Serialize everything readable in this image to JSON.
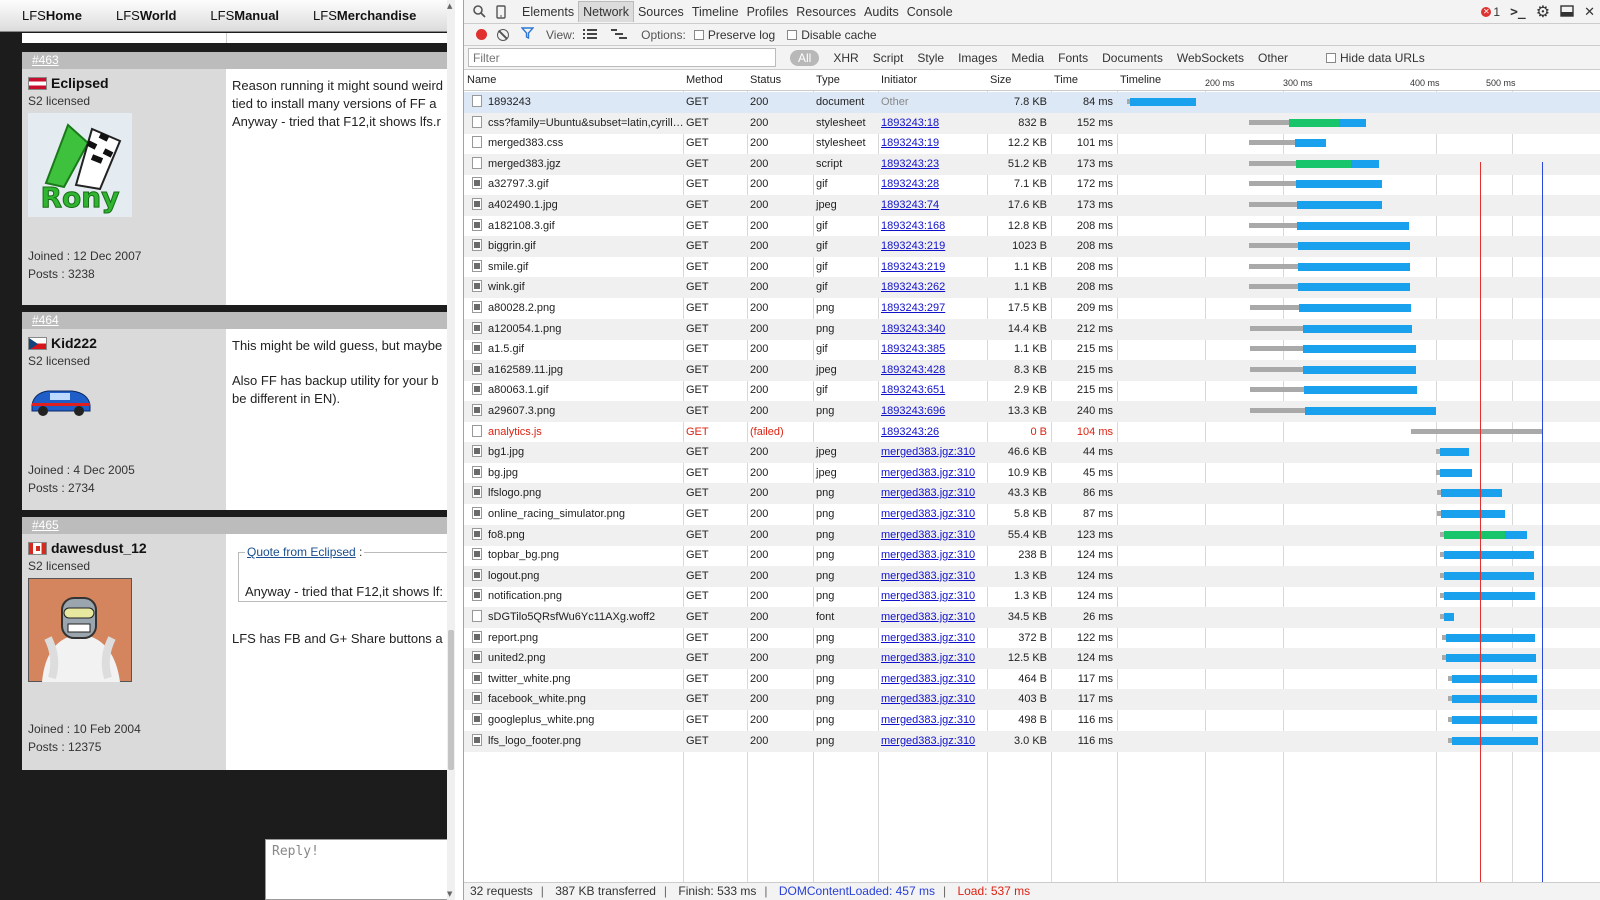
{
  "forum": {
    "nav": [
      {
        "prefix": "LFS",
        "strong": "Home"
      },
      {
        "prefix": "LFS",
        "strong": "World"
      },
      {
        "prefix": "LFS",
        "strong": "Manual"
      },
      {
        "prefix": "LFS",
        "strong": "Merchandise"
      }
    ],
    "posts": [
      {
        "number": "#463",
        "username": "Eclipsed",
        "license": "S2 licensed",
        "joined": "Joined : 12 Dec 2007",
        "posts": "Posts : 3238",
        "avatar_text": "Rony",
        "lines": [
          "Reason running it might sound weird",
          "tied to install many versions of FF a",
          "Anyway - tried that F12,it shows lfs.r"
        ]
      },
      {
        "number": "#464",
        "username": "Kid222",
        "license": "S2 licensed",
        "joined": "Joined : 4 Dec 2005",
        "posts": "Posts : 2734",
        "lines": [
          "This might be wild guess, but maybe",
          "Also FF has backup utility for your b",
          "be different in EN)."
        ]
      },
      {
        "number": "#465",
        "username": "dawesdust_12",
        "license": "S2 licensed",
        "joined": "Joined : 10 Feb 2004",
        "posts": "Posts : 12375",
        "quote_link": "Quote from Eclipsed",
        "quote_colon": " :",
        "quote_text": "Anyway - tried that F12,it shows lf:",
        "lines": [
          "LFS has FB and G+ Share buttons a"
        ]
      }
    ],
    "reply_placeholder": "Reply!"
  },
  "devtools": {
    "tabs": [
      "Elements",
      "Network",
      "Sources",
      "Timeline",
      "Profiles",
      "Resources",
      "Audits",
      "Console"
    ],
    "active_tab": "Network",
    "error_count": "1",
    "toolbar": {
      "view_label": "View:",
      "options_label": "Options:",
      "preserve_log": "Preserve log",
      "disable_cache": "Disable cache"
    },
    "filter": {
      "placeholder": "Filter",
      "types": [
        "All",
        "XHR",
        "Script",
        "Style",
        "Images",
        "Media",
        "Fonts",
        "Documents",
        "WebSockets",
        "Other"
      ],
      "hide_data_urls": "Hide data URLs"
    },
    "columns": [
      "Name",
      "Method",
      "Status",
      "Type",
      "Initiator",
      "Size",
      "Time",
      "Timeline"
    ],
    "timeline_ticks": [
      "200 ms",
      "300 ms",
      "400 ms",
      "500 ms"
    ],
    "requests": [
      {
        "name": "1893243",
        "method": "GET",
        "status": "200",
        "type": "document",
        "initiator": "Other",
        "size": "7.8 KB",
        "time": "84 ms"
      },
      {
        "name": "css?family=Ubuntu&subset=latin,cyrill…",
        "method": "GET",
        "status": "200",
        "type": "stylesheet",
        "initiator": "1893243:18",
        "size": "832 B",
        "time": "152 ms"
      },
      {
        "name": "merged383.css",
        "method": "GET",
        "status": "200",
        "type": "stylesheet",
        "initiator": "1893243:19",
        "size": "12.2 KB",
        "time": "101 ms"
      },
      {
        "name": "merged383.jgz",
        "method": "GET",
        "status": "200",
        "type": "script",
        "initiator": "1893243:23",
        "size": "51.2 KB",
        "time": "173 ms"
      },
      {
        "name": "a32797.3.gif",
        "method": "GET",
        "status": "200",
        "type": "gif",
        "initiator": "1893243:28",
        "size": "7.1 KB",
        "time": "172 ms"
      },
      {
        "name": "a402490.1.jpg",
        "method": "GET",
        "status": "200",
        "type": "jpeg",
        "initiator": "1893243:74",
        "size": "17.6 KB",
        "time": "173 ms"
      },
      {
        "name": "a182108.3.gif",
        "method": "GET",
        "status": "200",
        "type": "gif",
        "initiator": "1893243:168",
        "size": "12.8 KB",
        "time": "208 ms"
      },
      {
        "name": "biggrin.gif",
        "method": "GET",
        "status": "200",
        "type": "gif",
        "initiator": "1893243:219",
        "size": "1023 B",
        "time": "208 ms"
      },
      {
        "name": "smile.gif",
        "method": "GET",
        "status": "200",
        "type": "gif",
        "initiator": "1893243:219",
        "size": "1.1 KB",
        "time": "208 ms"
      },
      {
        "name": "wink.gif",
        "method": "GET",
        "status": "200",
        "type": "gif",
        "initiator": "1893243:262",
        "size": "1.1 KB",
        "time": "208 ms"
      },
      {
        "name": "a80028.2.png",
        "method": "GET",
        "status": "200",
        "type": "png",
        "initiator": "1893243:297",
        "size": "17.5 KB",
        "time": "209 ms"
      },
      {
        "name": "a120054.1.png",
        "method": "GET",
        "status": "200",
        "type": "png",
        "initiator": "1893243:340",
        "size": "14.4 KB",
        "time": "212 ms"
      },
      {
        "name": "a1.5.gif",
        "method": "GET",
        "status": "200",
        "type": "gif",
        "initiator": "1893243:385",
        "size": "1.1 KB",
        "time": "215 ms"
      },
      {
        "name": "a162589.11.jpg",
        "method": "GET",
        "status": "200",
        "type": "jpeg",
        "initiator": "1893243:428",
        "size": "8.3 KB",
        "time": "215 ms"
      },
      {
        "name": "a80063.1.gif",
        "method": "GET",
        "status": "200",
        "type": "gif",
        "initiator": "1893243:651",
        "size": "2.9 KB",
        "time": "215 ms"
      },
      {
        "name": "a29607.3.png",
        "method": "GET",
        "status": "200",
        "type": "png",
        "initiator": "1893243:696",
        "size": "13.3 KB",
        "time": "240 ms"
      },
      {
        "name": "analytics.js",
        "method": "GET",
        "status": "(failed)",
        "type": "",
        "initiator": "1893243:26",
        "size": "0 B",
        "time": "104 ms",
        "failed": true
      },
      {
        "name": "bg1.jpg",
        "method": "GET",
        "status": "200",
        "type": "jpeg",
        "initiator": "merged383.jgz:310",
        "size": "46.6 KB",
        "time": "44 ms"
      },
      {
        "name": "bg.jpg",
        "method": "GET",
        "status": "200",
        "type": "jpeg",
        "initiator": "merged383.jgz:310",
        "size": "10.9 KB",
        "time": "45 ms"
      },
      {
        "name": "lfslogo.png",
        "method": "GET",
        "status": "200",
        "type": "png",
        "initiator": "merged383.jgz:310",
        "size": "43.3 KB",
        "time": "86 ms"
      },
      {
        "name": "online_racing_simulator.png",
        "method": "GET",
        "status": "200",
        "type": "png",
        "initiator": "merged383.jgz:310",
        "size": "5.8 KB",
        "time": "87 ms"
      },
      {
        "name": "fo8.png",
        "method": "GET",
        "status": "200",
        "type": "png",
        "initiator": "merged383.jgz:310",
        "size": "55.4 KB",
        "time": "123 ms"
      },
      {
        "name": "topbar_bg.png",
        "method": "GET",
        "status": "200",
        "type": "png",
        "initiator": "merged383.jgz:310",
        "size": "238 B",
        "time": "124 ms"
      },
      {
        "name": "logout.png",
        "method": "GET",
        "status": "200",
        "type": "png",
        "initiator": "merged383.jgz:310",
        "size": "1.3 KB",
        "time": "124 ms"
      },
      {
        "name": "notification.png",
        "method": "GET",
        "status": "200",
        "type": "png",
        "initiator": "merged383.jgz:310",
        "size": "1.3 KB",
        "time": "124 ms"
      },
      {
        "name": "sDGTilo5QRsfWu6Yc11AXg.woff2",
        "method": "GET",
        "status": "200",
        "type": "font",
        "initiator": "merged383.jgz:310",
        "size": "34.5 KB",
        "time": "26 ms"
      },
      {
        "name": "report.png",
        "method": "GET",
        "status": "200",
        "type": "png",
        "initiator": "merged383.jgz:310",
        "size": "372 B",
        "time": "122 ms"
      },
      {
        "name": "united2.png",
        "method": "GET",
        "status": "200",
        "type": "png",
        "initiator": "merged383.jgz:310",
        "size": "12.5 KB",
        "time": "124 ms"
      },
      {
        "name": "twitter_white.png",
        "method": "GET",
        "status": "200",
        "type": "png",
        "initiator": "merged383.jgz:310",
        "size": "464 B",
        "time": "117 ms"
      },
      {
        "name": "facebook_white.png",
        "method": "GET",
        "status": "200",
        "type": "png",
        "initiator": "merged383.jgz:310",
        "size": "403 B",
        "time": "117 ms"
      },
      {
        "name": "googleplus_white.png",
        "method": "GET",
        "status": "200",
        "type": "png",
        "initiator": "merged383.jgz:310",
        "size": "498 B",
        "time": "116 ms"
      },
      {
        "name": "lfs_logo_footer.png",
        "method": "GET",
        "status": "200",
        "type": "png",
        "initiator": "merged383.jgz:310",
        "size": "3.0 KB",
        "time": "116 ms"
      }
    ],
    "summary": {
      "requests": "32 requests",
      "transferred": "387 KB transferred",
      "finish": "Finish: 533 ms",
      "dom_content_loaded": "DOMContentLoaded: 457 ms",
      "load": "Load: 537 ms"
    },
    "colors": {
      "waiting": "#19c56a",
      "download": "#1aa1ee",
      "queue": "#a9a9a9",
      "dom_line": "#2848e0",
      "load_line": "#e03030",
      "failed_text": "#dd2211"
    }
  }
}
